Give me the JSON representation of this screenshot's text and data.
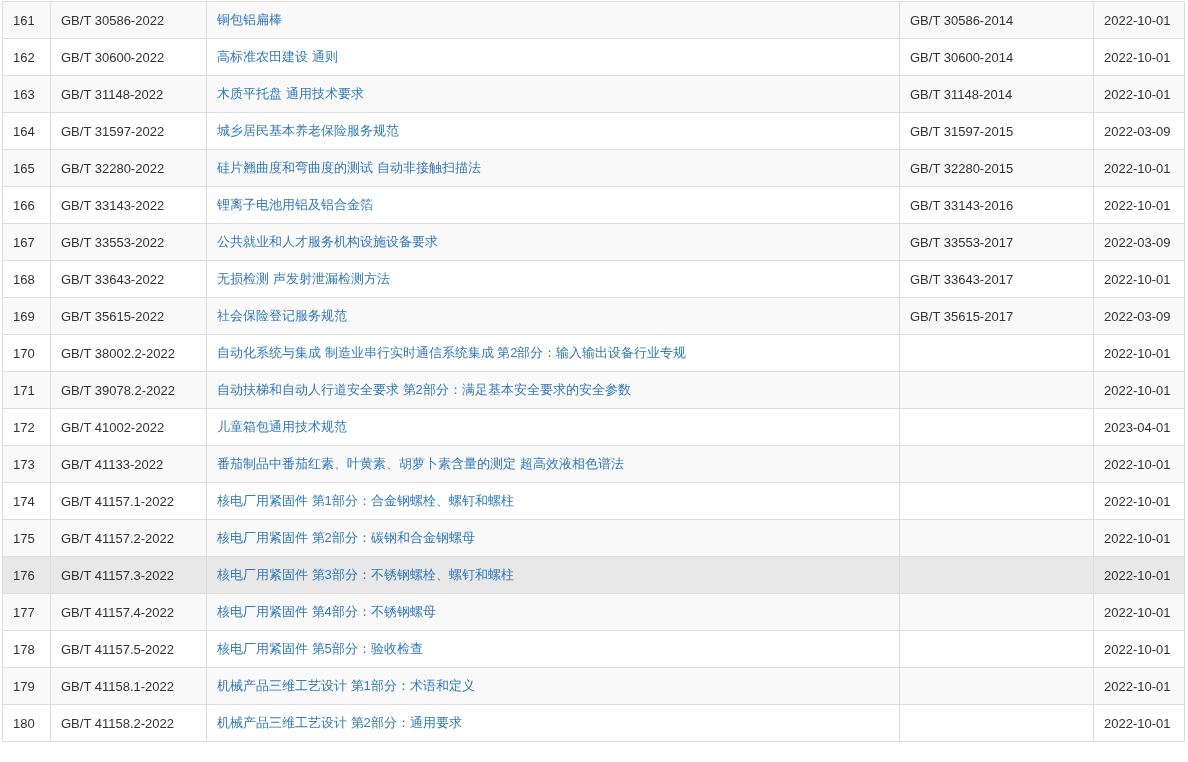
{
  "table": {
    "rows": [
      {
        "no": "161",
        "code": "GB/T 30586-2022",
        "title": "铜包铝扁棒",
        "replaces": "GB/T 30586-2014",
        "date": "2022-10-01",
        "highlighted": false
      },
      {
        "no": "162",
        "code": "GB/T 30600-2022",
        "title": "高标准农田建设 通则",
        "replaces": "GB/T 30600-2014",
        "date": "2022-10-01",
        "highlighted": false
      },
      {
        "no": "163",
        "code": "GB/T 31148-2022",
        "title": "木质平托盘 通用技术要求",
        "replaces": "GB/T 31148-2014",
        "date": "2022-10-01",
        "highlighted": false
      },
      {
        "no": "164",
        "code": "GB/T 31597-2022",
        "title": "城乡居民基本养老保险服务规范",
        "replaces": "GB/T 31597-2015",
        "date": "2022-03-09",
        "highlighted": false
      },
      {
        "no": "165",
        "code": "GB/T 32280-2022",
        "title": "硅片翘曲度和弯曲度的测试 自动非接触扫描法",
        "replaces": "GB/T 32280-2015",
        "date": "2022-10-01",
        "highlighted": false
      },
      {
        "no": "166",
        "code": "GB/T 33143-2022",
        "title": "锂离子电池用铝及铝合金箔",
        "replaces": "GB/T 33143-2016",
        "date": "2022-10-01",
        "highlighted": false
      },
      {
        "no": "167",
        "code": "GB/T 33553-2022",
        "title": "公共就业和人才服务机构设施设备要求",
        "replaces": "GB/T 33553-2017",
        "date": "2022-03-09",
        "highlighted": false
      },
      {
        "no": "168",
        "code": "GB/T 33643-2022",
        "title": "无损检测 声发射泄漏检测方法",
        "replaces": "GB/T 33643-2017",
        "date": "2022-10-01",
        "highlighted": false
      },
      {
        "no": "169",
        "code": "GB/T 35615-2022",
        "title": "社会保险登记服务规范",
        "replaces": "GB/T 35615-2017",
        "date": "2022-03-09",
        "highlighted": false
      },
      {
        "no": "170",
        "code": "GB/T 38002.2-2022",
        "title": "自动化系统与集成 制造业串行实时通信系统集成 第2部分：输入输出设备行业专规",
        "date": "2022-10-01",
        "highlighted": false
      },
      {
        "no": "171",
        "code": "GB/T 39078.2-2022",
        "title": "自动扶梯和自动人行道安全要求 第2部分：满足基本安全要求的安全参数",
        "date": "2022-10-01",
        "highlighted": false
      },
      {
        "no": "172",
        "code": "GB/T 41002-2022",
        "title": "儿童箱包通用技术规范",
        "date": "2023-04-01",
        "highlighted": false
      },
      {
        "no": "173",
        "code": "GB/T 41133-2022",
        "title": "番茄制品中番茄红素、叶黄素、胡萝卜素含量的测定 超高效液相色谱法",
        "date": "2022-10-01",
        "highlighted": false
      },
      {
        "no": "174",
        "code": "GB/T 41157.1-2022",
        "title": "核电厂用紧固件 第1部分：合金钢螺栓、螺钉和螺柱",
        "date": "2022-10-01",
        "highlighted": false
      },
      {
        "no": "175",
        "code": "GB/T 41157.2-2022",
        "title": "核电厂用紧固件 第2部分：碳钢和合金钢螺母",
        "date": "2022-10-01",
        "highlighted": false
      },
      {
        "no": "176",
        "code": "GB/T 41157.3-2022",
        "title": "核电厂用紧固件 第3部分：不锈钢螺栓、螺钉和螺柱",
        "date": "2022-10-01",
        "highlighted": true
      },
      {
        "no": "177",
        "code": "GB/T 41157.4-2022",
        "title": "核电厂用紧固件 第4部分：不锈钢螺母",
        "date": "2022-10-01",
        "highlighted": false
      },
      {
        "no": "178",
        "code": "GB/T 41157.5-2022",
        "title": "核电厂用紧固件 第5部分：验收检查",
        "date": "2022-10-01",
        "highlighted": false
      },
      {
        "no": "179",
        "code": "GB/T 41158.1-2022",
        "title": "机械产品三维工艺设计 第1部分：术语和定义",
        "date": "2022-10-01",
        "highlighted": false
      },
      {
        "no": "180",
        "code": "GB/T 41158.2-2022",
        "title": "机械产品三维工艺设计 第2部分：通用要求",
        "date": "2022-10-01",
        "highlighted": false
      }
    ]
  }
}
